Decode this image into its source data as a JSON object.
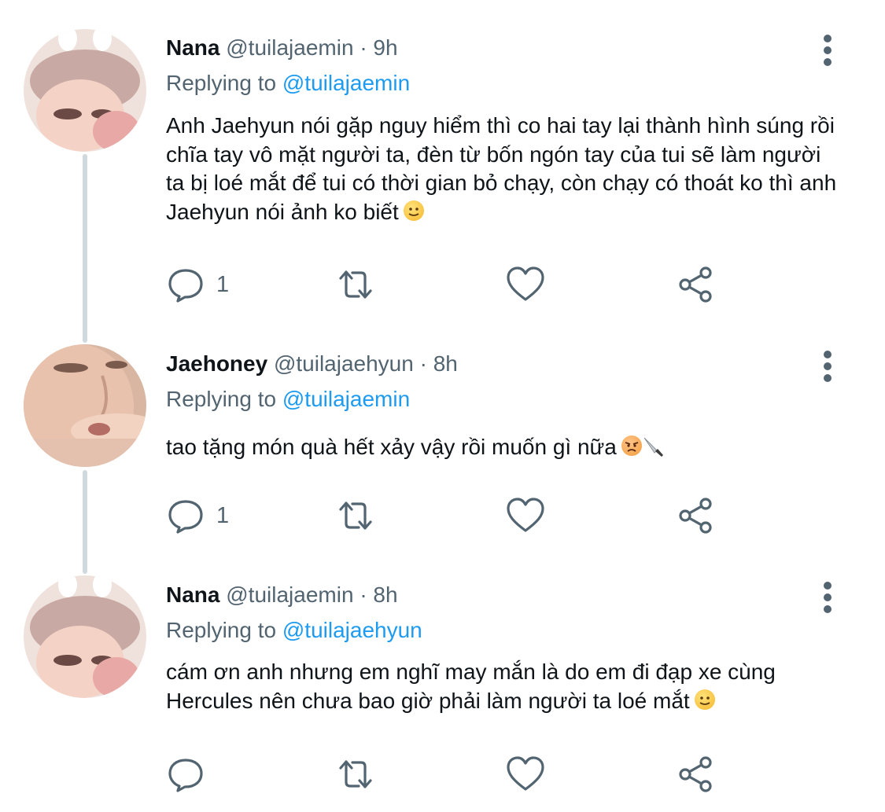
{
  "tweets": [
    {
      "name": "Nana",
      "handle": "@tuilajaemin",
      "separator": "·",
      "time": "9h",
      "replying_label": "Replying to",
      "replying_to": "@tuilajaemin",
      "text": "Anh Jaehyun nói gặp nguy hiểm thì co hai tay lại thành hình súng rồi chĩa tay vô mặt người ta, đèn từ bốn ngón tay của tui sẽ làm người ta bị loé mắt để tui có thời gian bỏ chạy, còn chạy có thoát ko thì anh Jaehyun nói ảnh ko biết",
      "reply_count": "1"
    },
    {
      "name": "Jaehoney",
      "handle": "@tuilajaehyun",
      "separator": "·",
      "time": "8h",
      "replying_label": "Replying to",
      "replying_to": "@tuilajaemin",
      "text": "tao tặng món quà hết xảy vậy rồi muốn gì nữa",
      "reply_count": "1"
    },
    {
      "name": "Nana",
      "handle": "@tuilajaemin",
      "separator": "·",
      "time": "8h",
      "replying_label": "Replying to",
      "replying_to": "@tuilajaehyun",
      "text": "cám ơn anh nhưng em nghĩ may mắn là do em đi đạp xe cùng Hercules nên chưa bao giờ phải làm người ta loé mắt",
      "reply_count": ""
    }
  ],
  "icons": {
    "reply": "reply-icon",
    "retweet": "retweet-icon",
    "like": "heart-icon",
    "share": "share-icon",
    "more": "more-options-icon",
    "emoji_smile": "slightly-smiling-face-emoji",
    "emoji_angry": "angry-face-emoji",
    "emoji_knife": "knife-emoji"
  },
  "colors": {
    "text": "#0f1419",
    "secondary": "#536471",
    "link": "#1d9bf0",
    "thread_line": "#cfd9de"
  }
}
